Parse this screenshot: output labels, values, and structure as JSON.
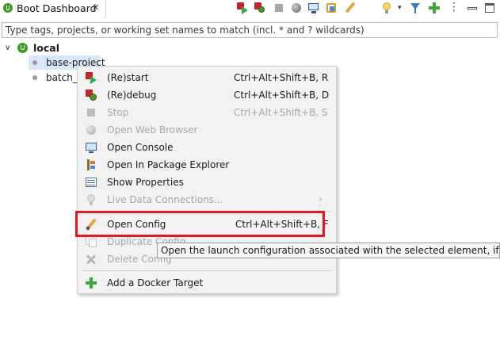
{
  "view": {
    "tab_title": "Boot Dashboard",
    "tab_close": "✕",
    "toolbar_menu": "⋮",
    "toolbar_dropdown": "▾"
  },
  "filter": {
    "placeholder": "Type tags, projects, or working set names to match (incl. * and ? wildcards)",
    "value": ""
  },
  "tree": {
    "toggle": "∨",
    "root_label": "local",
    "items": [
      {
        "label": "base-project",
        "selected": true
      },
      {
        "label": "batch_C"
      }
    ]
  },
  "context_menu": {
    "items": [
      {
        "label": "(Re)start",
        "shortcut": "Ctrl+Alt+Shift+B, R",
        "enabled": true,
        "icon": "restart-icon"
      },
      {
        "label": "(Re)debug",
        "shortcut": "Ctrl+Alt+Shift+B, D",
        "enabled": true,
        "icon": "debug-icon"
      },
      {
        "label": "Stop",
        "shortcut": "Ctrl+Alt+Shift+B, S",
        "enabled": false,
        "icon": "stop-icon"
      },
      {
        "label": "Open Web Browser",
        "shortcut": "",
        "enabled": false,
        "icon": "globe-icon"
      },
      {
        "label": "Open Console",
        "shortcut": "",
        "enabled": true,
        "icon": "console-icon"
      },
      {
        "label": "Open In Package Explorer",
        "shortcut": "",
        "enabled": true,
        "icon": "package-explorer-icon"
      },
      {
        "label": "Show Properties",
        "shortcut": "",
        "enabled": true,
        "icon": "properties-icon"
      },
      {
        "label": "Live Data Connections...",
        "shortcut": "",
        "enabled": false,
        "icon": "lightbulb-icon",
        "submenu_arrow": "›"
      },
      {
        "label": "Open Config",
        "shortcut": "Ctrl+Alt+Shift+B, F",
        "enabled": true,
        "icon": "pencil-icon",
        "highlighted": true
      },
      {
        "label": "Duplicate Config",
        "shortcut": "",
        "enabled": false,
        "icon": "duplicate-icon"
      },
      {
        "label": "Delete Config",
        "shortcut": "",
        "enabled": false,
        "icon": "delete-icon"
      },
      {
        "label": "Add a Docker Target",
        "shortcut": "",
        "enabled": true,
        "icon": "add-icon"
      }
    ]
  },
  "tooltip": {
    "text": "Open the launch configuration associated with the selected element, if one exists"
  },
  "colors": {
    "highlight_border": "#e01a22",
    "selection": "#d9e8f9",
    "boot_green": "#3a9d23",
    "disabled_text": "#a8a8a8"
  }
}
